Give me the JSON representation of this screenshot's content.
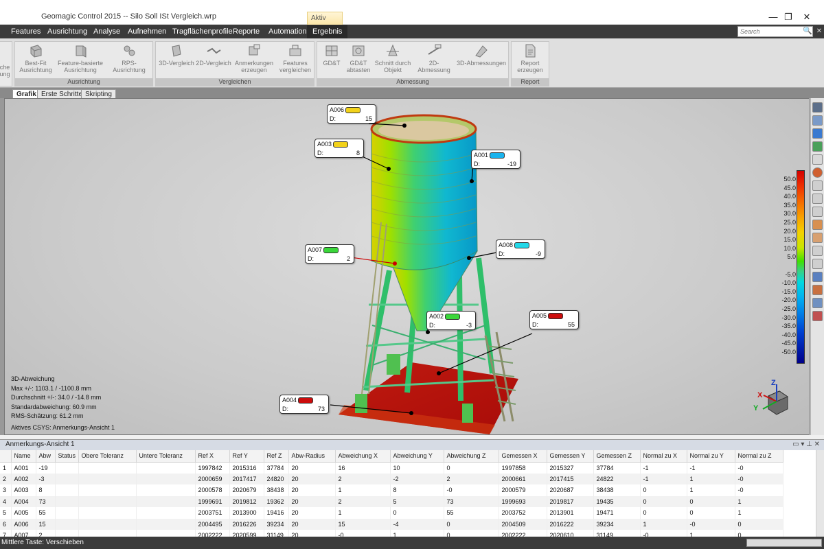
{
  "window": {
    "title": "Geomagic Control 2015 -- Silo Soll ISt Vergleich.wrp",
    "context_tab": "Aktiv",
    "minimize": "—",
    "restore": "❐",
    "close": "✕"
  },
  "menu": {
    "items": [
      "Features",
      "Ausrichtung",
      "Analyse",
      "Aufnehmen",
      "Tragflächenprofile",
      "Reporte",
      "Automation",
      "Ergebnis"
    ],
    "active": "Ergebnis",
    "search_placeholder": "Search"
  },
  "ribbon": {
    "groups": [
      {
        "label": "Ausrichtung",
        "buttons": [
          "Best-Fit\nAusrichtung",
          "Feature-basierte\nAusrichtung",
          "RPS-Ausrichtung"
        ],
        "partial": "che\nung"
      },
      {
        "label": "Vergleichen",
        "buttons": [
          "3D-Vergleich",
          "2D-Vergleich",
          "Anmerkungen\nerzeugen",
          "Features\nvergleichen"
        ]
      },
      {
        "label": "Abmessung",
        "buttons": [
          "GD&T",
          "GD&T\nabtasten",
          "Schnitt durch\nObjekt",
          "2D-Abmessung",
          "3D-Abmessungen"
        ]
      },
      {
        "label": "Report",
        "buttons": [
          "Report\nerzeugen"
        ]
      }
    ]
  },
  "doc_tabs": [
    "Grafik",
    "Erste Schritte",
    "Skripting"
  ],
  "annotations": [
    {
      "id": "A006",
      "d_label": "D:",
      "value": "15",
      "color": "#f2d21a"
    },
    {
      "id": "A003",
      "d_label": "D:",
      "value": "8",
      "color": "#f2d21a"
    },
    {
      "id": "A001",
      "d_label": "D:",
      "value": "-19",
      "color": "#1ab4ee"
    },
    {
      "id": "A007",
      "d_label": "D:",
      "value": "2",
      "color": "#3ad63a"
    },
    {
      "id": "A008",
      "d_label": "D:",
      "value": "-9",
      "color": "#22d8e8"
    },
    {
      "id": "A002",
      "d_label": "D:",
      "value": "-3",
      "color": "#3ad63a"
    },
    {
      "id": "A005",
      "d_label": "D:",
      "value": "55",
      "color": "#cc0c0c"
    },
    {
      "id": "A004",
      "d_label": "D:",
      "value": "73",
      "color": "#cc0c0c"
    }
  ],
  "stats": {
    "title": "3D-Abweichung",
    "max": "Max +/-: 1103.1 / -1100.8 mm",
    "avg": "Durchschnitt +/-: 34.0 / -14.8 mm",
    "std": "Standardabweichung: 60.9 mm",
    "rms": "RMS-Schätzung: 61.2 mm",
    "csys": "Aktives CSYS: Anmerkungs-Ansicht 1"
  },
  "color_scale": [
    "50.0",
    "45.0",
    "40.0",
    "35.0",
    "30.0",
    "25.0",
    "20.0",
    "15.0",
    "10.0",
    "5.0",
    "-5.0",
    "-10.0",
    "-15.0",
    "-20.0",
    "-25.0",
    "-30.0",
    "-35.0",
    "-40.0",
    "-45.0",
    "-50.0"
  ],
  "axes": {
    "x": "X",
    "y": "Y",
    "z": "Z"
  },
  "panel": {
    "title": "Anmerkungs-Ansicht 1",
    "controls": "▭  ▾  ⊥  ✕",
    "columns": [
      "",
      "Name",
      "Abw",
      "Status",
      "Obere Toleranz",
      "Untere Toleranz",
      "Ref X",
      "Ref Y",
      "Ref Z",
      "Abw-Radius",
      "Abweichung X",
      "Abweichung Y",
      "Abweichung Z",
      "Gemessen X",
      "Gemessen Y",
      "Gemessen Z",
      "Normal zu X",
      "Normal zu Y",
      "Normal zu Z"
    ],
    "rows": [
      [
        "1",
        "A001",
        "-19",
        "",
        "",
        "",
        "1997842",
        "2015316",
        "37784",
        "20",
        "16",
        "10",
        "0",
        "1997858",
        "2015327",
        "37784",
        "-1",
        "-1",
        "-0"
      ],
      [
        "2",
        "A002",
        "-3",
        "",
        "",
        "",
        "2000659",
        "2017417",
        "24820",
        "20",
        "2",
        "-2",
        "2",
        "2000661",
        "2017415",
        "24822",
        "-1",
        "1",
        "-0"
      ],
      [
        "3",
        "A003",
        "8",
        "",
        "",
        "",
        "2000578",
        "2020679",
        "38438",
        "20",
        "1",
        "8",
        "-0",
        "2000579",
        "2020687",
        "38438",
        "0",
        "1",
        "-0"
      ],
      [
        "4",
        "A004",
        "73",
        "",
        "",
        "",
        "1999691",
        "2019812",
        "19362",
        "20",
        "2",
        "5",
        "73",
        "1999693",
        "2019817",
        "19435",
        "0",
        "0",
        "1"
      ],
      [
        "5",
        "A005",
        "55",
        "",
        "",
        "",
        "2003751",
        "2013900",
        "19416",
        "20",
        "1",
        "0",
        "55",
        "2003752",
        "2013901",
        "19471",
        "0",
        "0",
        "1"
      ],
      [
        "6",
        "A006",
        "15",
        "",
        "",
        "",
        "2004495",
        "2016226",
        "39234",
        "20",
        "15",
        "-4",
        "0",
        "2004509",
        "2016222",
        "39234",
        "1",
        "-0",
        "0"
      ],
      [
        "7",
        "A007",
        "2",
        "",
        "",
        "",
        "2002222",
        "2020599",
        "31149",
        "20",
        "-0",
        "1",
        "0",
        "2002222",
        "2020610",
        "31149",
        "-0",
        "1",
        "0"
      ]
    ]
  },
  "status": {
    "text": "Mittlere Taste: Verschieben"
  }
}
